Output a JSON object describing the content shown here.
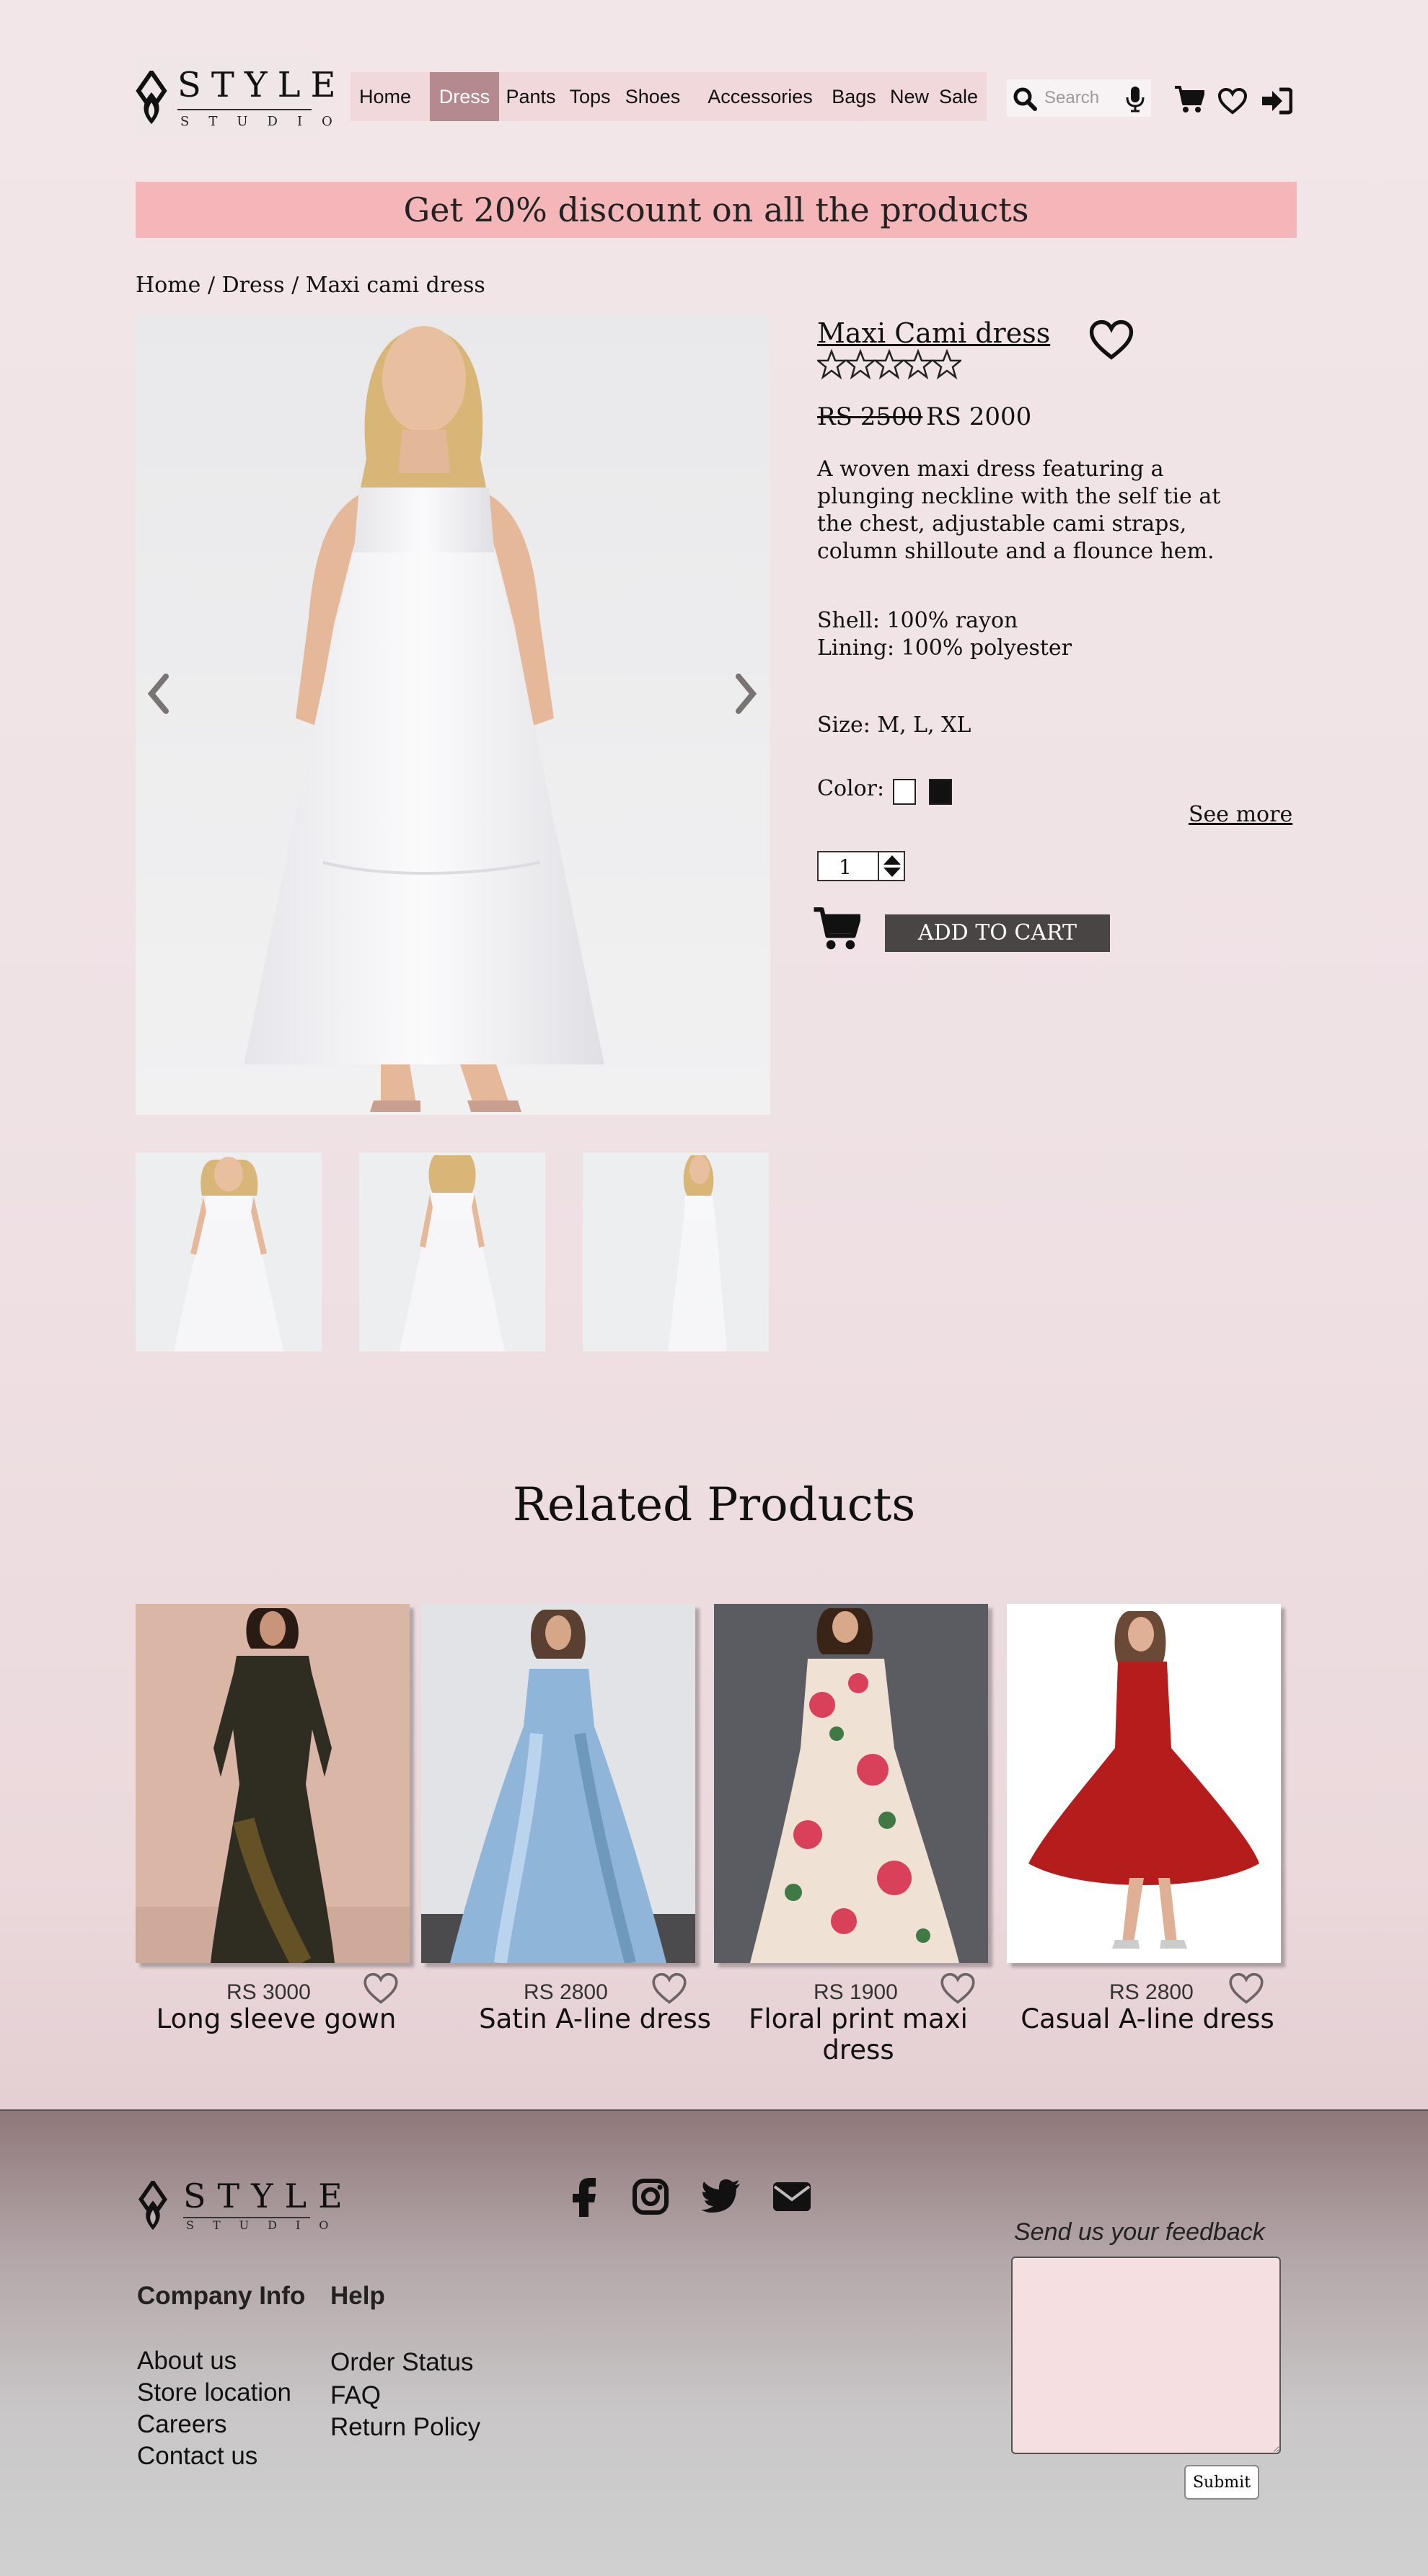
{
  "brand": {
    "name": "STYLE",
    "sub": "STUDIO"
  },
  "nav": {
    "items": [
      {
        "label": "Home"
      },
      {
        "label": "Dress"
      },
      {
        "label": "Pants"
      },
      {
        "label": "Tops"
      },
      {
        "label": "Shoes"
      },
      {
        "label": "Accessories"
      },
      {
        "label": "Bags"
      },
      {
        "label": "New"
      },
      {
        "label": "Sale"
      }
    ],
    "active": "Dress"
  },
  "search": {
    "placeholder": "Search"
  },
  "promo": {
    "text": "Get 20% discount on all the products"
  },
  "breadcrumb": {
    "text": "Home / Dress / Maxi cami dress"
  },
  "product": {
    "title": "Maxi Cami dress",
    "rating": 0,
    "rating_max": 5,
    "price_old": "RS 2500",
    "price_new": "RS 2000",
    "description": "A woven maxi dress featuring a plunging neckline with the self tie at the chest, adjustable cami straps, column shilloute and a flounce hem.",
    "material": [
      "Shell: 100% rayon",
      "Lining: 100% polyester"
    ],
    "size": "Size: M, L, XL",
    "color_label": "Color:",
    "colors": [
      "#ffffff",
      "#111111"
    ],
    "see_more": "See more",
    "quantity": "1",
    "add_to_cart": "ADD TO CART"
  },
  "related": {
    "title": "Related Products",
    "items": [
      {
        "price": "RS 3000",
        "name": "Long sleeve gown"
      },
      {
        "price": "RS 2800",
        "name": "Satin A-line dress"
      },
      {
        "price": "RS 1900",
        "name": "Floral print maxi dress"
      },
      {
        "price": "RS 2800",
        "name": "Casual A-line dress"
      }
    ]
  },
  "footer": {
    "company_head": "Company Info",
    "company_links": [
      "About us",
      "Store location",
      "Careers",
      "Contact us"
    ],
    "help_head": "Help",
    "help_links": [
      "Order Status",
      "FAQ",
      "Return Policy"
    ],
    "feedback_label": "Send us your feedback",
    "submit": "Submit"
  },
  "icons": [
    "search-icon",
    "microphone-icon",
    "cart-icon",
    "heart-icon",
    "sign-in-icon",
    "facebook-icon",
    "instagram-icon",
    "twitter-icon",
    "envelope-icon"
  ]
}
